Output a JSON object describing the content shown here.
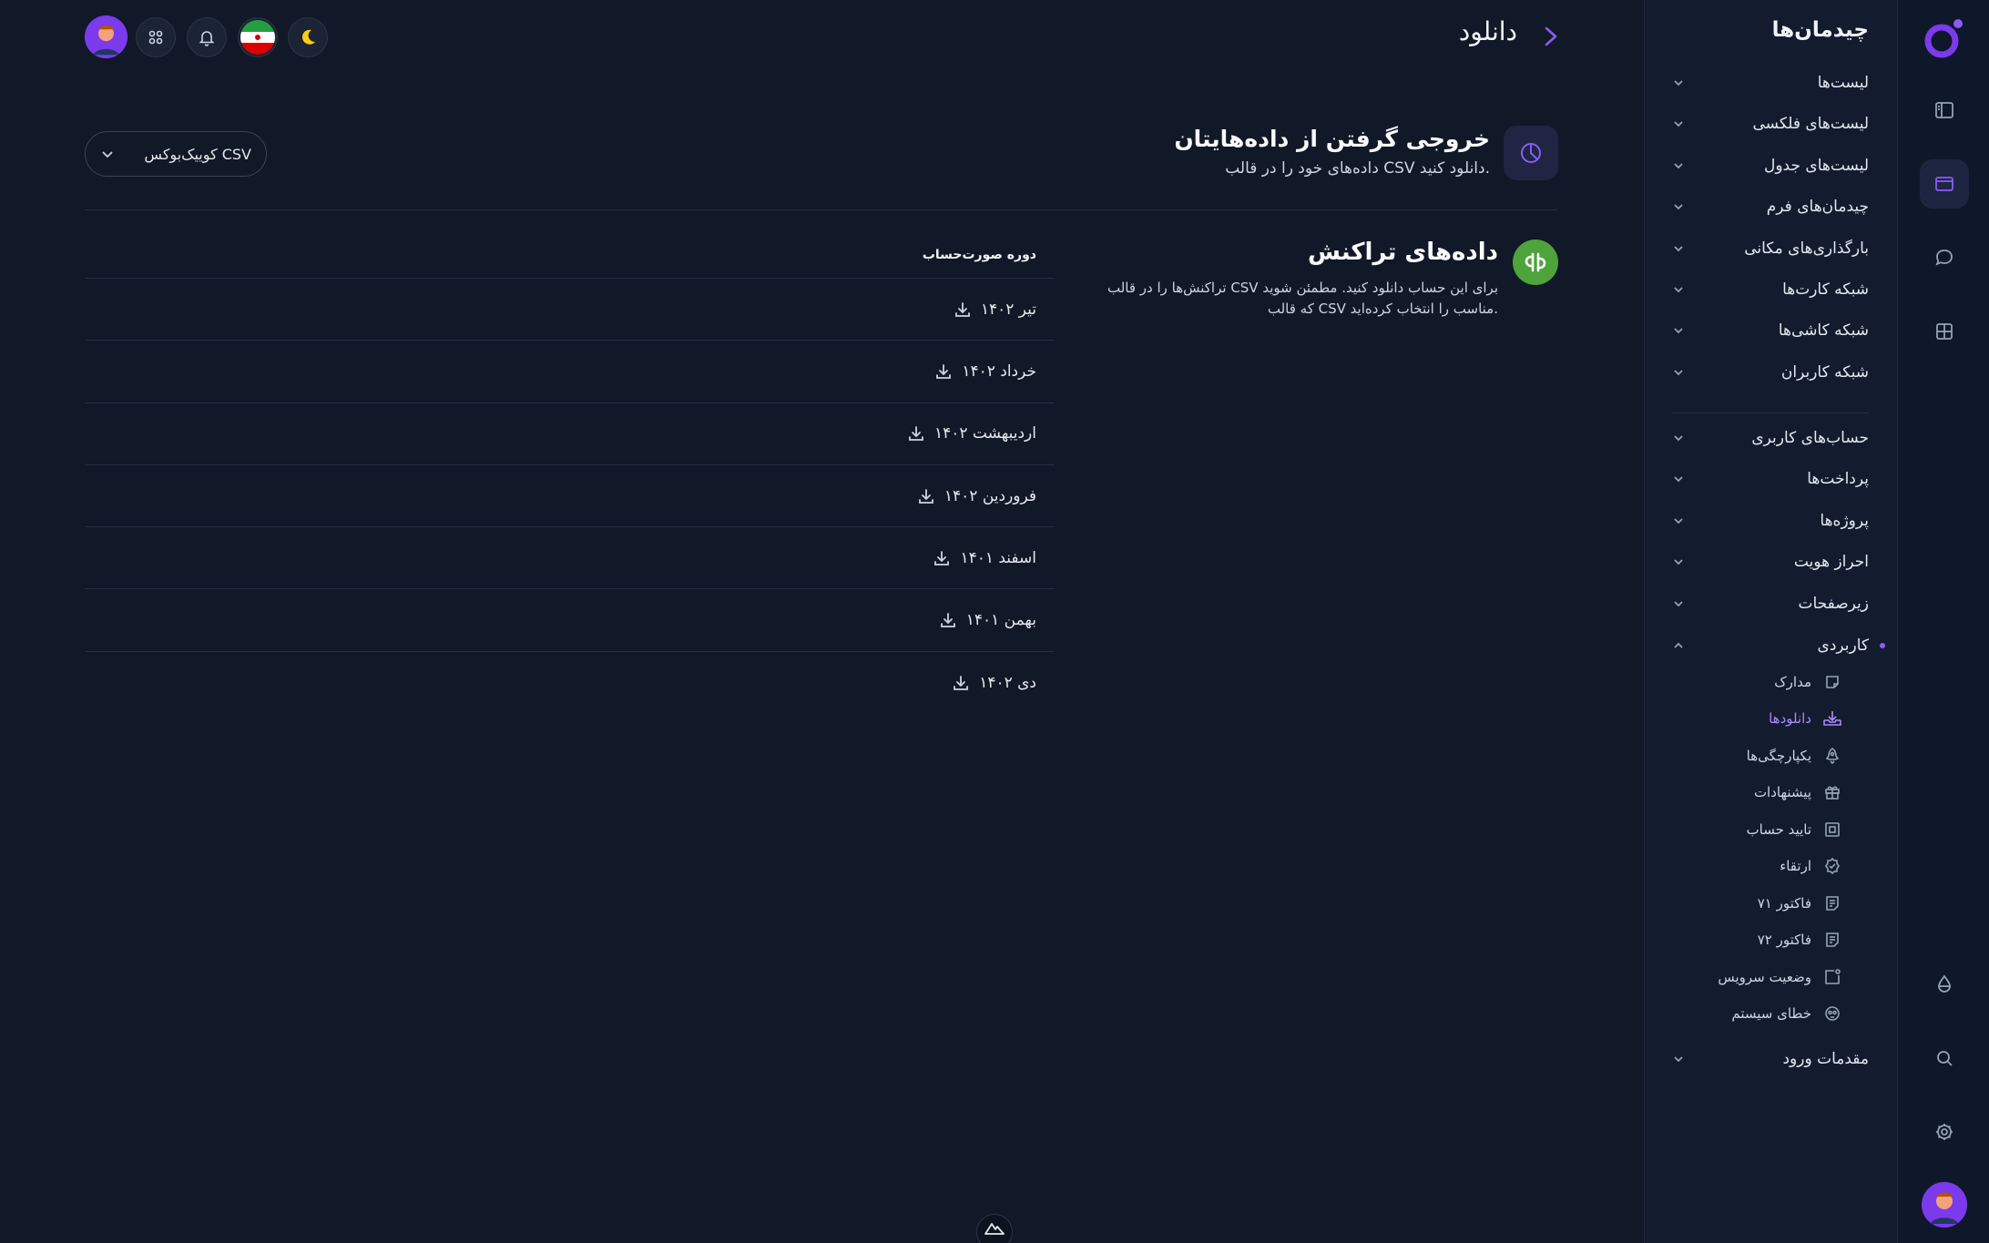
{
  "header": {
    "title": "دانلود"
  },
  "subnav": {
    "title": "چیدمان‌ها",
    "group1": [
      {
        "label": "لیست‌ها"
      },
      {
        "label": "لیست‌های فلکسی"
      },
      {
        "label": "لیست‌های جدول"
      },
      {
        "label": "چیدمان‌های فرم"
      },
      {
        "label": "بارگذاری‌های مکانی"
      },
      {
        "label": "شبکه کارت‌ها"
      },
      {
        "label": "شبکه کاشی‌ها"
      },
      {
        "label": "شبکه کاربران"
      }
    ],
    "group2": [
      {
        "label": "حساب‌های کاربری"
      },
      {
        "label": "پرداخت‌ها"
      },
      {
        "label": "پروژه‌ها"
      },
      {
        "label": "احراز هویت"
      },
      {
        "label": "زیرصفحات"
      },
      {
        "label": "کاربردی"
      }
    ],
    "sub_items": [
      {
        "label": "مدارک",
        "icon": "document-icon"
      },
      {
        "label": "دانلودها",
        "icon": "download-tray-icon"
      },
      {
        "label": "یکپارچگی‌ها",
        "icon": "rocket-icon"
      },
      {
        "label": "پیشنهادات",
        "icon": "gift-icon"
      },
      {
        "label": "تایید حساب",
        "icon": "verify-box-icon"
      },
      {
        "label": "ارتقاء",
        "icon": "badge-check-icon"
      },
      {
        "label": "فاکتور ۷۱",
        "icon": "invoice-icon"
      },
      {
        "label": "فاکتور ۷۲",
        "icon": "invoice-icon"
      },
      {
        "label": "وضعیت سرویس",
        "icon": "status-icon"
      },
      {
        "label": "خطای سیستم",
        "icon": "skull-icon"
      }
    ],
    "last": {
      "label": "مقدمات ورود"
    }
  },
  "export": {
    "title": "خروجی گرفتن از داده‌هایتان",
    "subtitle": "داده‌های خود را در قالب CSV دانلود کنید.",
    "format_value": "کوییک‌بوکس CSV"
  },
  "transactions": {
    "title": "داده‌های تراکنش",
    "description": "تراکنش‌ها را در قالب CSV برای این حساب دانلود کنید. مطمئن شوید که قالب CSV مناسب را انتخاب کرده‌اید."
  },
  "table": {
    "header": "دوره صورت‌حساب",
    "rows": [
      "تیر ۱۴۰۲",
      "خرداد ۱۴۰۲",
      "اردیبهشت ۱۴۰۲",
      "فروردین ۱۴۰۲",
      "اسفند ۱۴۰۱",
      "بهمن ۱۴۰۱",
      "دی ۱۴۰۲"
    ]
  },
  "colors": {
    "accent": "#8b5cf6",
    "background": "#111827",
    "quickbooks": "#4ea33a"
  }
}
